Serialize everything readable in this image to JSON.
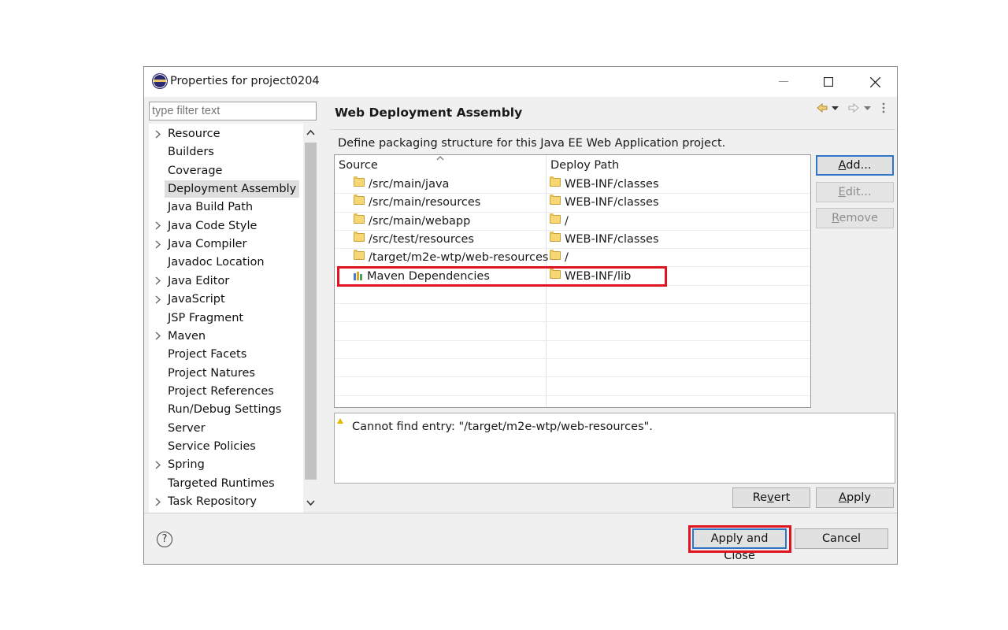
{
  "window": {
    "title": "Properties for project0204"
  },
  "filter": {
    "placeholder": "type filter text"
  },
  "tree": {
    "items": [
      {
        "label": "Resource",
        "expandable": true
      },
      {
        "label": "Builders",
        "expandable": false
      },
      {
        "label": "Coverage",
        "expandable": false
      },
      {
        "label": "Deployment Assembly",
        "expandable": false,
        "selected": true
      },
      {
        "label": "Java Build Path",
        "expandable": false
      },
      {
        "label": "Java Code Style",
        "expandable": true
      },
      {
        "label": "Java Compiler",
        "expandable": true
      },
      {
        "label": "Javadoc Location",
        "expandable": false
      },
      {
        "label": "Java Editor",
        "expandable": true
      },
      {
        "label": "JavaScript",
        "expandable": true
      },
      {
        "label": "JSP Fragment",
        "expandable": false
      },
      {
        "label": "Maven",
        "expandable": true
      },
      {
        "label": "Project Facets",
        "expandable": false
      },
      {
        "label": "Project Natures",
        "expandable": false
      },
      {
        "label": "Project References",
        "expandable": false
      },
      {
        "label": "Run/Debug Settings",
        "expandable": false
      },
      {
        "label": "Server",
        "expandable": false
      },
      {
        "label": "Service Policies",
        "expandable": false
      },
      {
        "label": "Spring",
        "expandable": true
      },
      {
        "label": "Targeted Runtimes",
        "expandable": false
      },
      {
        "label": "Task Repository",
        "expandable": true
      }
    ]
  },
  "page": {
    "title": "Web Deployment Assembly",
    "description": "Define packaging structure for this Java EE Web Application project."
  },
  "table": {
    "headers": {
      "source": "Source",
      "deploy_path": "Deploy Path"
    },
    "rows": [
      {
        "source": "/src/main/java",
        "deploy": "WEB-INF/classes",
        "icon": "folder-icon"
      },
      {
        "source": "/src/main/resources",
        "deploy": "WEB-INF/classes",
        "icon": "folder-icon"
      },
      {
        "source": "/src/main/webapp",
        "deploy": "/",
        "icon": "folder-icon"
      },
      {
        "source": "/src/test/resources",
        "deploy": "WEB-INF/classes",
        "icon": "folder-icon"
      },
      {
        "source": "/target/m2e-wtp/web-resources",
        "deploy": "/",
        "icon": "folder-icon"
      },
      {
        "source": "Maven Dependencies",
        "deploy": "WEB-INF/lib",
        "icon": "maven-library-icon",
        "highlighted": true
      }
    ]
  },
  "side_buttons": {
    "add": {
      "mnemonic": "A",
      "rest": "dd..."
    },
    "edit": {
      "mnemonic": "E",
      "rest": "dit..."
    },
    "remove": {
      "mnemonic": "R",
      "rest": "emove"
    }
  },
  "message": {
    "text": "Cannot find entry: \"/target/m2e-wtp/web-resources\"."
  },
  "page_buttons": {
    "revert": {
      "before": "Re",
      "mnemonic": "v",
      "after": "ert"
    },
    "apply": {
      "mnemonic": "A",
      "rest": "pply"
    }
  },
  "footer": {
    "apply_close": "Apply and Close",
    "cancel": "Cancel",
    "help": "?"
  },
  "colors": {
    "highlight_border": "#e0141e",
    "default_button_border": "#2f76c8"
  }
}
